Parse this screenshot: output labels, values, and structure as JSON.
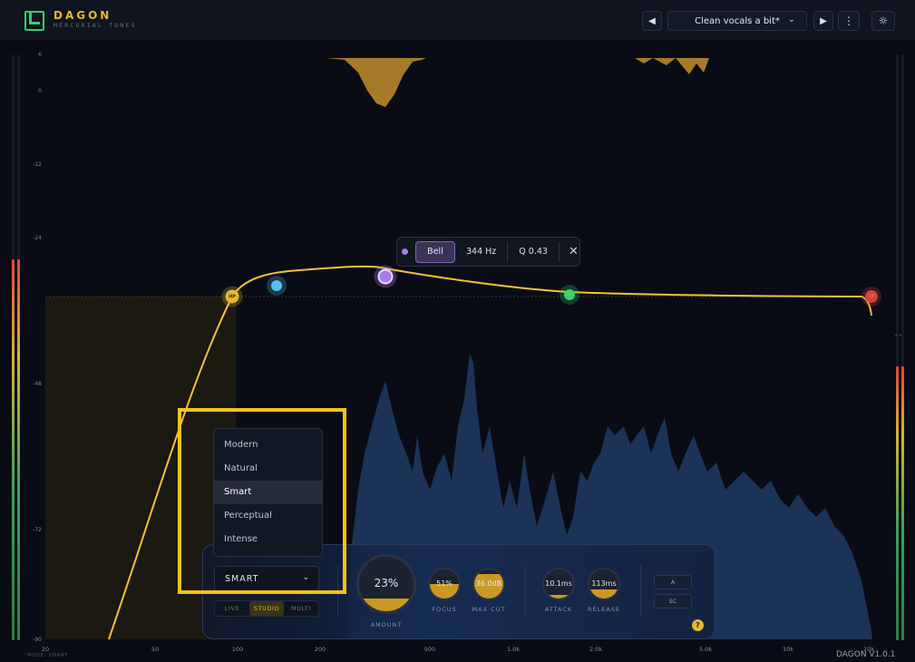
{
  "header": {
    "title": "DAGON",
    "subtitle": "MERCURIAL TONES",
    "preset_name": "Clean vocals a bit*",
    "prev_icon": "triangle-left-icon",
    "next_icon": "triangle-right-icon",
    "menu_icon": "kebab-icon",
    "settings_icon": "sun-gear-icon"
  },
  "graph": {
    "y_labels": [
      "6",
      "0",
      "-12",
      "-24",
      "-48",
      "-72",
      "-90"
    ],
    "x_labels": [
      "20",
      "50",
      "100",
      "200",
      "500",
      "1.0k",
      "2.0k",
      "5.0k",
      "10k",
      "20k"
    ],
    "meter_marker": "- -"
  },
  "band_popup": {
    "type": "Bell",
    "frequency": "344 Hz",
    "q": "Q 0.43",
    "close_icon": "close-icon"
  },
  "nodes": {
    "hp": "HP",
    "lp": "LP"
  },
  "dropdown": {
    "items": [
      "Modern",
      "Natural",
      "Smart",
      "Perceptual",
      "Intense"
    ],
    "selected": "Smart"
  },
  "controls": {
    "mode_value": "SMART",
    "seg": [
      "LIVE",
      "STUDIO",
      "MULTI"
    ],
    "seg_active": "STUDIO",
    "amount": {
      "value": "23%",
      "label": "AMOUNT",
      "level": 0.23
    },
    "focus": {
      "value": "51%",
      "label": "FOCUS",
      "level": 0.51
    },
    "max_cut": {
      "value": "36.0dB",
      "label": "MAX CUT",
      "level": 0.85
    },
    "attack": {
      "value": "10.1ms",
      "label": "ATTACK",
      "level": 0.12
    },
    "release": {
      "value": "113ms",
      "label": "RELEASE",
      "level": 0.3
    },
    "a_label": "A",
    "sc_label": "SC",
    "help": "?"
  },
  "footer": {
    "mode_text": "MODE: SMART",
    "version": "DAGON V1.0.1"
  },
  "colors": {
    "accent": "#e8b730",
    "logo": "#2fd16b",
    "curve": "#f2c23a",
    "spectrum": "#2a4a80",
    "band_bell": "#a67cf0"
  }
}
